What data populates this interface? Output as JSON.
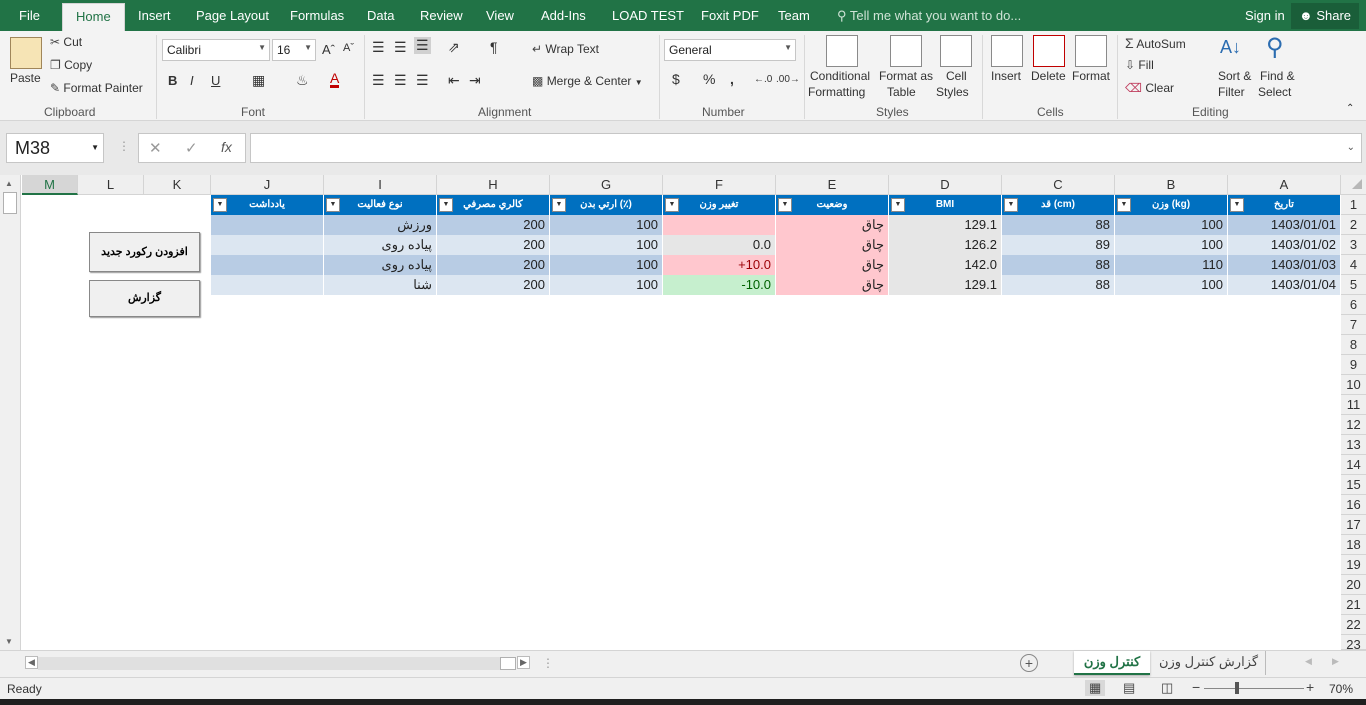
{
  "tabs": {
    "file": "File",
    "home": "Home",
    "insert": "Insert",
    "page_layout": "Page Layout",
    "formulas": "Formulas",
    "data": "Data",
    "review": "Review",
    "view": "View",
    "addins": "Add-Ins",
    "load_test": "LOAD TEST",
    "foxit": "Foxit PDF",
    "team": "Team"
  },
  "tellme": "Tell me what you want to do...",
  "signin": "Sign in",
  "share": "Share",
  "clipboard": {
    "paste": "Paste",
    "cut": "Cut",
    "copy": "Copy",
    "format_painter": "Format Painter",
    "label": "Clipboard"
  },
  "font": {
    "name": "Calibri",
    "size": "16",
    "bold": "B",
    "italic": "I",
    "underline": "U",
    "label": "Font"
  },
  "alignment": {
    "wrap": "Wrap Text",
    "merge": "Merge & Center",
    "label": "Alignment"
  },
  "number": {
    "format": "General",
    "currency": "$",
    "percent": "%",
    "comma": ",",
    "label": "Number"
  },
  "styles": {
    "conditional": "Conditional",
    "formatting": "Formatting",
    "format_as": "Format as",
    "table": "Table",
    "cell": "Cell",
    "cell_styles": "Styles",
    "label": "Styles"
  },
  "cells": {
    "insert": "Insert",
    "delete": "Delete",
    "format": "Format",
    "label": "Cells"
  },
  "editing": {
    "autosum": "AutoSum",
    "fill": "Fill",
    "clear": "Clear",
    "sort": "Sort &",
    "filter": "Filter",
    "find": "Find &",
    "select": "Select",
    "label": "Editing"
  },
  "namebox": "M38",
  "fx": "fx",
  "columns": [
    "M",
    "L",
    "K",
    "J",
    "I",
    "H",
    "G",
    "F",
    "E",
    "D",
    "C",
    "B",
    "A"
  ],
  "rows": [
    "1",
    "2",
    "3",
    "4",
    "5",
    "6",
    "7",
    "8",
    "9",
    "10",
    "11",
    "12",
    "13",
    "14",
    "15",
    "16",
    "17",
    "18",
    "19",
    "20",
    "21",
    "22",
    "23"
  ],
  "headers": {
    "j": "يادداشت",
    "i": "نوع فعاليت",
    "h": "كالري مصرفي",
    "g": "ارتي بدن (٪)",
    "f": "تغيير وزن",
    "e": "وضعيت",
    "d": "BMI",
    "c": "قد (cm)",
    "b": "وزن (kg)",
    "a": "تاريخ"
  },
  "table": [
    {
      "a": "1403/01/01",
      "b": "100",
      "c": "88",
      "d": "129.1",
      "e": "چاق",
      "f": "",
      "g": "100",
      "h": "200",
      "i": "ورزش",
      "j": ""
    },
    {
      "a": "1403/01/02",
      "b": "100",
      "c": "89",
      "d": "126.2",
      "e": "چاق",
      "f": "0.0",
      "g": "100",
      "h": "200",
      "i": "پیاده روی",
      "j": ""
    },
    {
      "a": "1403/01/03",
      "b": "110",
      "c": "88",
      "d": "142.0",
      "e": "چاق",
      "f": "+10.0",
      "g": "100",
      "h": "200",
      "i": "پیاده روی",
      "j": ""
    },
    {
      "a": "1403/01/04",
      "b": "100",
      "c": "88",
      "d": "129.1",
      "e": "چاق",
      "f": "-10.0",
      "g": "100",
      "h": "200",
      "i": "شنا",
      "j": ""
    }
  ],
  "form_buttons": {
    "add": "افزودن ركورد جديد",
    "report": "گزارش"
  },
  "sheets": {
    "active": "كنترل وزن",
    "other": "گزارش كنترل وزن"
  },
  "status": {
    "ready": "Ready",
    "zoom": "70%"
  },
  "colors": {
    "accent": "#217346",
    "header_fill": "#0070c0",
    "fat_fill": "#ffc7ce",
    "gain_fill": "#ffc7ce",
    "loss_fill": "#c6efce",
    "row_band": "#dce6f1"
  }
}
